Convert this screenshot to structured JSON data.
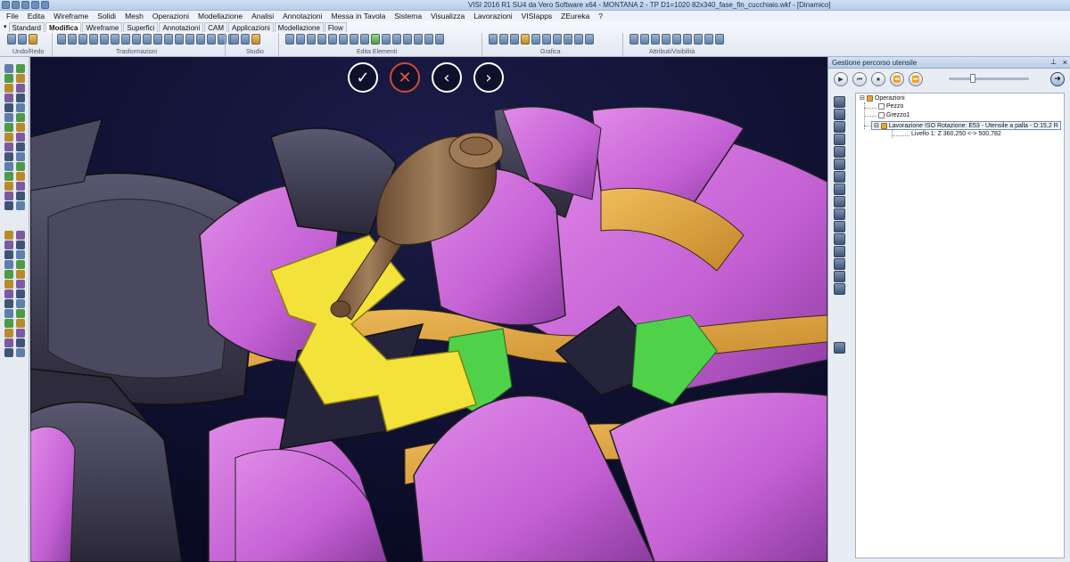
{
  "window": {
    "title": "VISI 2016 R1 SU4 da Vero Software x64 - MONTANA 2 - TP D1=1020 82x340_fase_fin_cucchiaio.wkf - [Dinamico]"
  },
  "menu": [
    "File",
    "Edita",
    "Wireframe",
    "Solidi",
    "Mesh",
    "Operazioni",
    "Modellazione",
    "Analisi",
    "Annotazioni",
    "Messa in Tavola",
    "Sistema",
    "Visualizza",
    "Lavorazioni",
    "VISIapps",
    "ZEureka",
    "?"
  ],
  "ribbon": {
    "tabs": [
      "Standard",
      "Modifica",
      "Wireframe",
      "Superfici",
      "Annotazioni",
      "CAM",
      "Applicazioni",
      "Modellazione",
      "Flow"
    ],
    "active_tab": "Modifica",
    "groups": [
      "Undo/Redo",
      "Trasformazioni",
      "Studio",
      "Edita Elementi",
      "Grafica",
      "Attributi/Visibilità"
    ]
  },
  "viewport": {
    "nav_buttons": [
      {
        "name": "confirm",
        "glyph": "✓"
      },
      {
        "name": "cancel",
        "glyph": "✕"
      },
      {
        "name": "previous",
        "glyph": "‹"
      },
      {
        "name": "next",
        "glyph": "›"
      }
    ],
    "colors": {
      "background": "#0f1030",
      "part_magenta": "#c65fd6",
      "part_dark": "#3c3a52",
      "toolpath_orange": "#e3a53c",
      "selected_yellow": "#f2e23a",
      "highlight_green": "#4fd24a",
      "tool_brown": "#8a6a4a"
    }
  },
  "panel": {
    "title": "Gestione percorso utensile",
    "pin_glyph": "⊥",
    "close_glyph": "×",
    "player_buttons": [
      "▶",
      "⏮",
      "⏹",
      "⏪",
      "⏩"
    ],
    "tree": {
      "root": "Operazioni",
      "children": [
        "Pezzo",
        "Grezzo1"
      ],
      "operation": "Lavorazione ISO  Rotazione: E53 - Utensile a palla - D:15,2 R",
      "level": "Livello 1: Z 360,250 <-> 500,782"
    }
  }
}
